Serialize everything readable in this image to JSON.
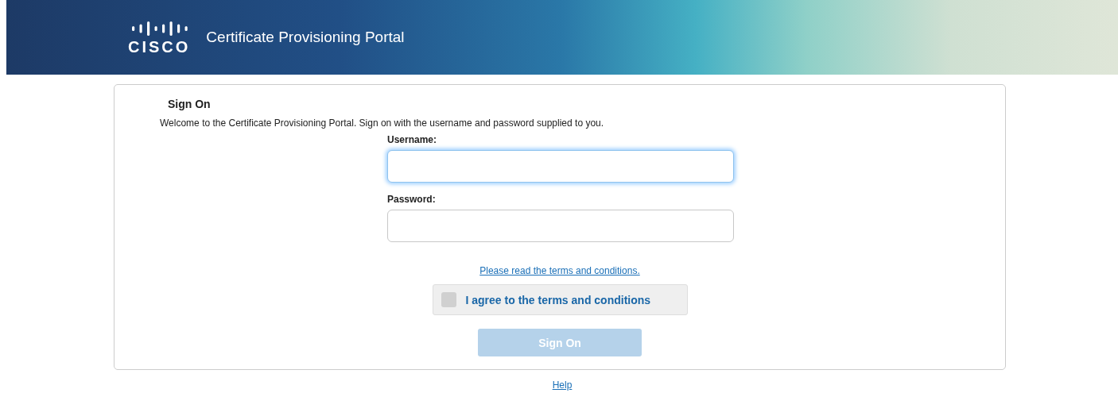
{
  "header": {
    "logo_text": "CISCO",
    "title": "Certificate Provisioning Portal"
  },
  "sign_on": {
    "title": "Sign On",
    "intro": "Welcome to the Certificate Provisioning Portal. Sign on with the username and password supplied to you.",
    "fields": [
      {
        "label": "Username:",
        "focused": true
      },
      {
        "label": "Password:",
        "focused": false
      }
    ],
    "terms_link": "Please read the terms and conditions.",
    "agree": {
      "label": "I agree to the terms and conditions",
      "checked": false
    },
    "submit": {
      "label": "Sign On",
      "disabled": true
    }
  },
  "footer": {
    "help_link": "Help"
  }
}
